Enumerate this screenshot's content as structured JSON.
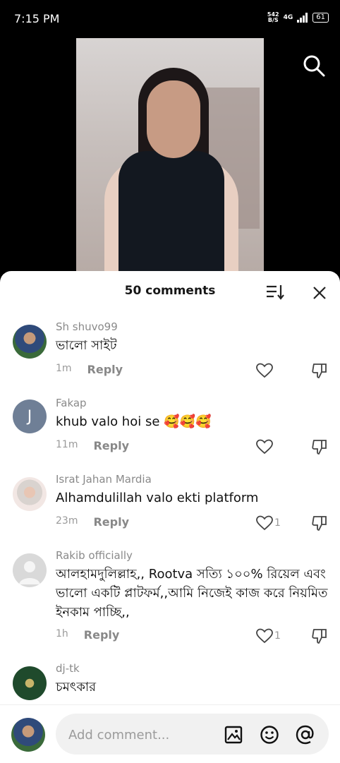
{
  "status": {
    "time": "7:15 PM",
    "net_speed_top": "542",
    "net_speed_bottom": "B/S",
    "network": "4G",
    "battery": "61"
  },
  "sheet": {
    "title": "50 comments"
  },
  "comments": [
    {
      "user": "Sh shuvo99",
      "text": "ভালো সাইট",
      "time": "1m",
      "reply": "Reply",
      "likes": ""
    },
    {
      "user": "Fakap",
      "initial": "J",
      "text": "khub valo hoi se 🥰🥰🥰",
      "time": "11m",
      "reply": "Reply",
      "likes": ""
    },
    {
      "user": "Israt Jahan Mardia",
      "text": "Alhamdulillah valo ekti platform",
      "time": "23m",
      "reply": "Reply",
      "likes": "1"
    },
    {
      "user": "Rakib officially",
      "text": "আলহামদুলিল্লাহ,, Rootva সত্যি ১০০% রিয়েল এবং ভালো একটি প্লাটফর্ম,,আমি নিজেই কাজ করে নিয়মিত ইনকাম পাচ্ছি,,",
      "time": "1h",
      "reply": "Reply",
      "likes": "1"
    },
    {
      "user": "dj-tk",
      "text": "চমৎকার",
      "time": "",
      "reply": "",
      "likes": ""
    }
  ],
  "input": {
    "placeholder": "Add comment..."
  },
  "icons": {
    "search": "search-icon",
    "sort": "sort-icon",
    "close": "close-icon",
    "like": "heart-icon",
    "dislike": "dislike-icon",
    "image": "image-icon",
    "emoji": "emoji-icon",
    "mention": "at-icon"
  },
  "colors": {
    "accent": "#000000",
    "text": "#111111",
    "muted": "#8a8a8a"
  }
}
